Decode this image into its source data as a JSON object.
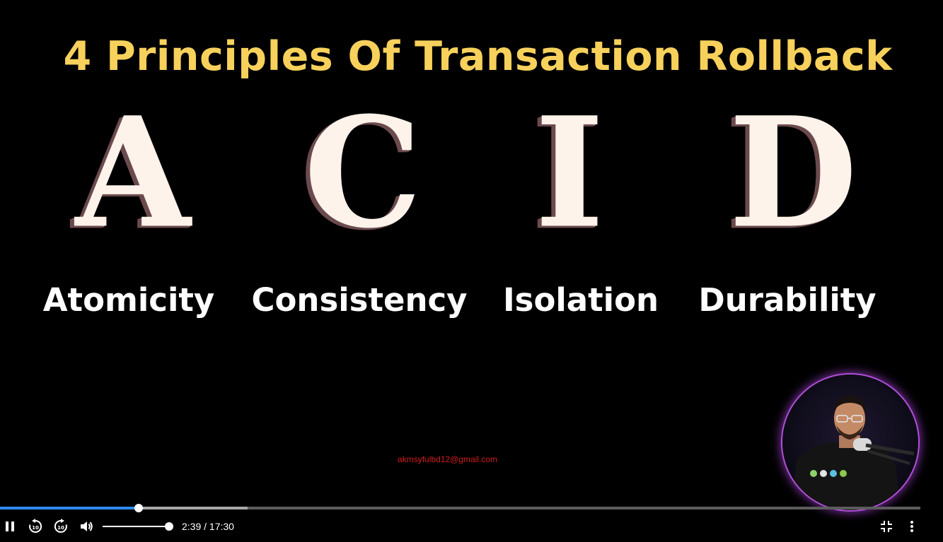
{
  "slide": {
    "title": "4 Principles Of Transaction Rollback",
    "letters": [
      "A",
      "C",
      "I",
      "D"
    ],
    "words": [
      "Atomicity",
      "Consistency",
      "Isolation",
      "Durability"
    ],
    "title_color": "#f7d15b"
  },
  "watermark": "akmsyfulbd12@gmail.com",
  "player": {
    "current_time": "2:39",
    "duration": "17:30",
    "time_display": "2:39 / 17:30",
    "progress_fraction": 0.151,
    "buffered_fraction": 0.269,
    "volume_fraction": 1.0,
    "accent_color": "#2f8bf0",
    "icons": {
      "play_pause": "pause-icon",
      "rewind": "rewind-10-icon",
      "forward": "forward-10-icon",
      "volume": "volume-icon",
      "exit_fullscreen": "exit-fullscreen-icon",
      "more": "more-vertical-icon"
    }
  }
}
